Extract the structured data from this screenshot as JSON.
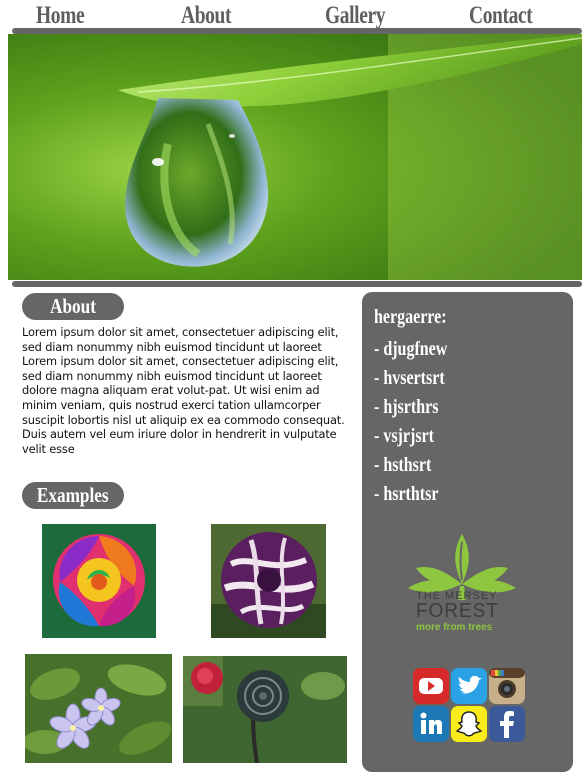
{
  "nav": {
    "items": [
      "Home",
      "About",
      "Gallery",
      "Contact"
    ]
  },
  "about": {
    "heading": "About",
    "paragraph": "Lorem ipsum dolor sit amet, consectetuer adipiscing elit, sed diam nonummy nibh euismod tincidunt ut laoreet Lorem ipsum dolor sit amet, consectetuer adipiscing elit, sed diam nonummy nibh euismod tincidunt ut laoreet dolore magna aliquam erat volut-pat. Ut wisi enim ad minim veniam, quis nostrud exerci tation ullamcorper suscipit lobortis nisl ut aliquip ex ea commodo consequat. Duis autem vel eum iriure dolor in hendrerit in vulputate velit esse"
  },
  "examples": {
    "heading": "Examples",
    "images": [
      "rainbow-rose",
      "striped-rose",
      "periwinkle-flowers",
      "black-rose"
    ]
  },
  "sidebar": {
    "title": "hergaerre:",
    "items": [
      "- djugfnew",
      "- hvsertsrt",
      "- hjsrthrs",
      "- vsjrjsrt",
      "- hsthsrt",
      "- hsrthtsr"
    ],
    "logo": {
      "line1": "THE MERSEY",
      "line2": "FOREST",
      "line3": "more from trees"
    },
    "social_icons": [
      "youtube-icon",
      "twitter-icon",
      "instagram-icon",
      "linkedin-icon",
      "snapchat-icon",
      "facebook-icon"
    ]
  },
  "colors": {
    "accent_gray": "#666666",
    "leaf_green": "#8ec63f"
  }
}
